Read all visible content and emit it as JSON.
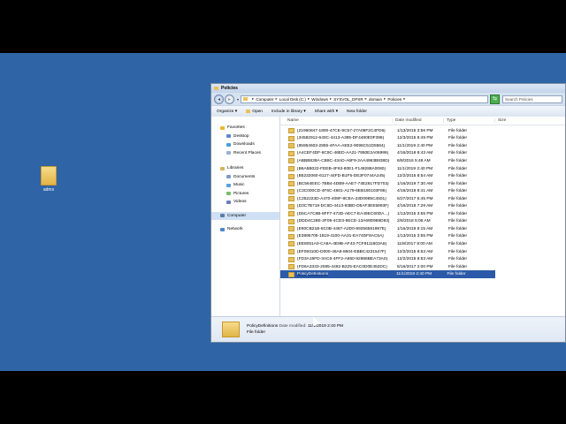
{
  "desktop": {
    "icon_label": "admx"
  },
  "window": {
    "title": "Policies",
    "address": {
      "breadcrumbs": [
        "Computer",
        "Local Disk (C:)",
        "Windows",
        "SYSVOL_DFSR",
        "domain",
        "Policies"
      ],
      "search_placeholder": "Search Policies"
    },
    "toolbar": {
      "organize": "Organize ▾",
      "open": "Open",
      "include": "Include in library ▾",
      "share": "Share with ▾",
      "new_folder": "New folder"
    },
    "nav": {
      "favorites": "Favorites",
      "desktop": "Desktop",
      "downloads": "Downloads",
      "recent": "Recent Places",
      "libraries": "Libraries",
      "documents": "Documents",
      "music": "Music",
      "pictures": "Pictures",
      "videos": "Videos",
      "computer": "Computer",
      "network": "Network"
    },
    "columns": {
      "name": "Name",
      "date": "Date modified",
      "type": "Type",
      "size": "Size"
    },
    "rows": [
      {
        "name": "{21960847-1800-47CE-9C57-27A08F2C4FD6}",
        "date": "1/13/2015 3:56 PM",
        "type": "File folder"
      },
      {
        "name": "{34582912-640C-4413-A385-DF4480E0F398}",
        "date": "12/3/2015 8:49 PM",
        "type": "File folder"
      },
      {
        "name": "{85964603-2855-4FAA-AEE2-9096C51D5584}",
        "date": "11/1/2019 2:40 PM",
        "type": "File folder"
      },
      {
        "name": "{A4CEF4DF-6C9C-46ED-AA21-7950E2A06999}",
        "date": "4/16/2018 8:43 AM",
        "type": "File folder"
      },
      {
        "name": "{ABBB839A-CB8C-43AD-A6F9-2AA4963B838D}",
        "date": "6/8/2016 5:48 AM",
        "type": "File folder"
      },
      {
        "name": "{B6A5B022-FEEB-4F63-80E1-F148288A0080}",
        "date": "11/1/2019 2:40 PM",
        "type": "File folder"
      },
      {
        "name": "{B5232060-6127-44FD-B1F5-DE3F0744A245}",
        "date": "12/2/2015 8:54 AM",
        "type": "File folder"
      },
      {
        "name": "{BC564EEC-7BB4-4DB9-AAE7-74E2617FD703}",
        "date": "1/16/2019 7:30 AM",
        "type": "File folder"
      },
      {
        "name": "{C3C000CD-4F6C-4601-A179-6EB180103F86}",
        "date": "4/16/2018 8:41 AM",
        "type": "File folder"
      },
      {
        "name": "{C252223D-A470-408F-8CEA-23D0985C4501}",
        "date": "6/27/2017 5:45 PM",
        "type": "File folder"
      },
      {
        "name": "{D3C7B718-DC6D-4413-93BD-D5AF3EE5893F}",
        "date": "4/16/2018 7:29 AM",
        "type": "File folder"
      },
      {
        "name": "{D5CA7C8B-8FF7-472D-AEC7-EA49EC60DA...}",
        "date": "1/13/2015 3:55 PM",
        "type": "File folder"
      },
      {
        "name": "{DDD4C28E-2F09-4CD3-8ECE-13A69D985D83}",
        "date": "2/8/2018 5:06 AM",
        "type": "File folder"
      },
      {
        "name": "{E90CB21B-8C0B-4467-A2D0-89256591987E}",
        "date": "1/16/2019 8:15 AM",
        "type": "File folder"
      },
      {
        "name": "{E3895705-1819-4100-AA31-EA74DF8AC5A}",
        "date": "1/13/2015 3:55 PM",
        "type": "File folder"
      },
      {
        "name": "{EE8051A0-CA8A-4E9B-AF43-7CF9111803A8}",
        "date": "11/8/2017 8:00 AM",
        "type": "File folder"
      },
      {
        "name": "{EF09310D-D000-46A8-8604-EBBC4231547F}",
        "date": "12/2/2015 8:53 AM",
        "type": "File folder"
      },
      {
        "name": "{FD3A19FD-3AC6-4FF2-A660-92868BEA73A0}",
        "date": "12/2/2015 8:53 AM",
        "type": "File folder"
      },
      {
        "name": "{FD6A3333-2085-4492-B225-EAC0D0E452DC}",
        "date": "5/16/2017 2:00 PM",
        "type": "File folder"
      }
    ],
    "selected_row": {
      "name": "PolicyDefinitions",
      "date": "11/1/2019 2:40 PM",
      "type": "File folder"
    },
    "details": {
      "name": "PolicyDefinitions",
      "date_label": "Date modified:",
      "date_value": "11/1/2019 2:40 PM",
      "type": "File folder"
    }
  }
}
